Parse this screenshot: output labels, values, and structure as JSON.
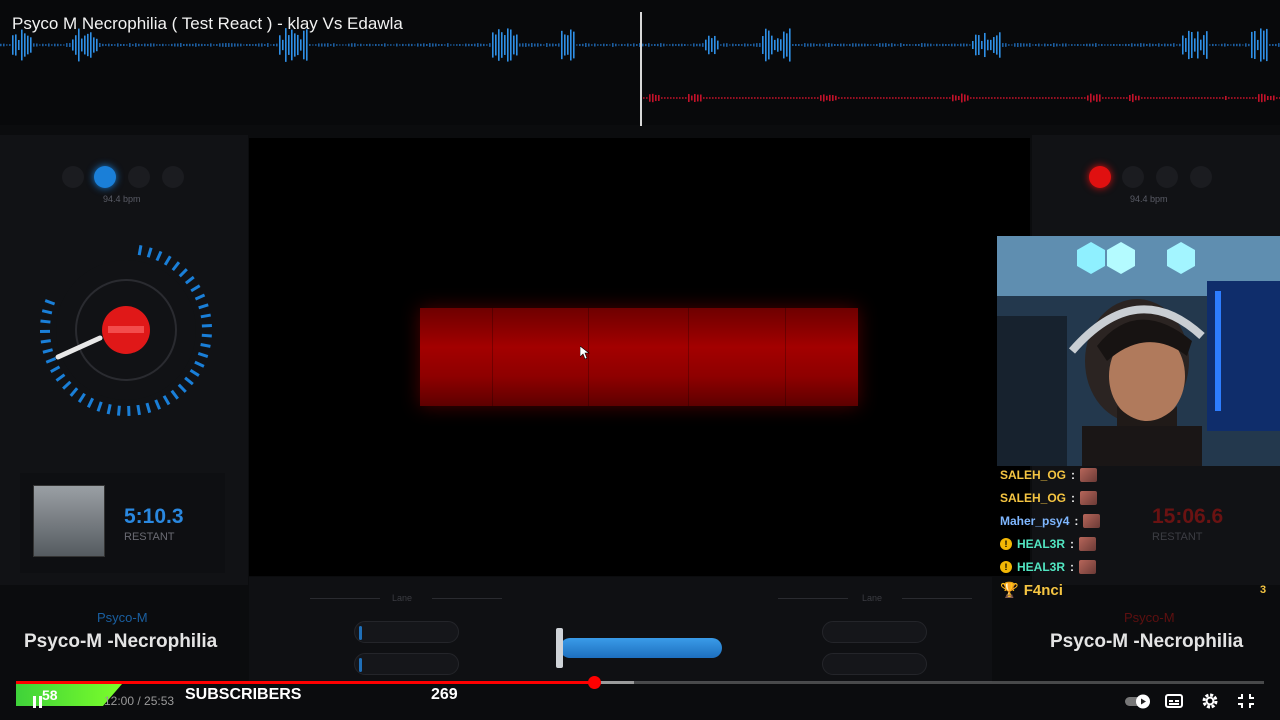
{
  "video": {
    "title": "Psyco M Necrophilia ( Test React ) - klay Vs Edawla"
  },
  "deck_left": {
    "bpm": "94.4 bpm",
    "time": "5:10.3",
    "time_label": "RESTANT",
    "artist": "Psyco-M",
    "track": "Psyco-M -Necrophilia",
    "accent": "#1a7fd8"
  },
  "deck_right": {
    "bpm": "94.4 bpm",
    "time": "15:06.6",
    "time_label": "RESTANT",
    "artist": "Psyco-M",
    "track": "Psyco-M -Necrophilia",
    "accent": "#e01010"
  },
  "mixer": {
    "lane_left": "Lane",
    "lane_right": "Lane"
  },
  "chat": [
    {
      "user": "SALEH_OG",
      "color": "#f5c542",
      "badge": ""
    },
    {
      "user": "SALEH_OG",
      "color": "#f5c542",
      "badge": ""
    },
    {
      "user": "Maher_psy4",
      "color": "#7fb7ff",
      "badge": ""
    },
    {
      "user": "HEAL3R",
      "color": "#52e6c2",
      "badge": "warn"
    },
    {
      "user": "HEAL3R",
      "color": "#52e6c2",
      "badge": "warn"
    }
  ],
  "chat_separator": ":",
  "chat_top": {
    "user": "F4nci",
    "count": "3",
    "color": "#f5c542"
  },
  "subscribers": {
    "count": "58",
    "label": "SUBSCRIBERS",
    "total": "269"
  },
  "player": {
    "time": "12:00 / 25:53",
    "progress": 0.463,
    "buffered": 0.495
  }
}
